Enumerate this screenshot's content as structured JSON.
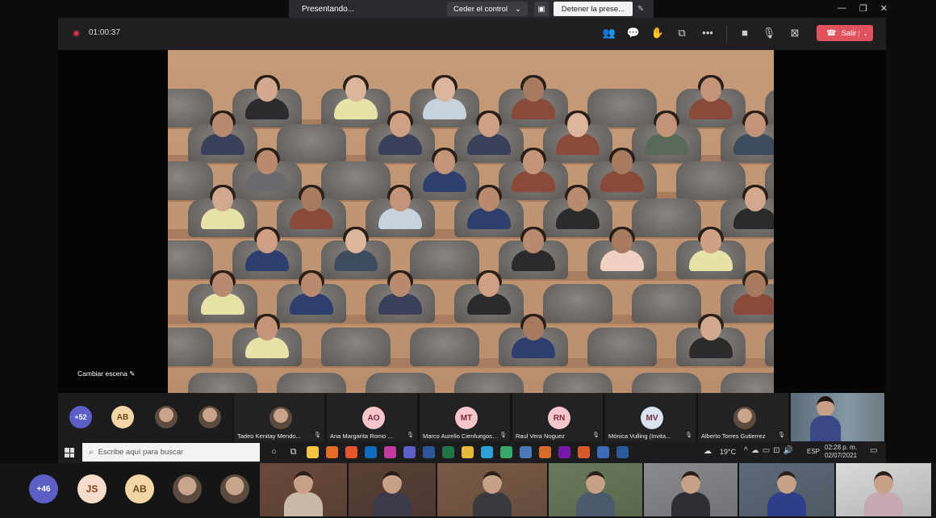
{
  "share_bar": {
    "label": "Presentando...",
    "give_control": "Ceder el control",
    "stop_presenting": "Detener la prese..."
  },
  "toolbar": {
    "timer": "01:00:37",
    "leave_label": "Salir"
  },
  "stage": {
    "change_scene": "Cambiar escena"
  },
  "strip": {
    "overflow_count": "+52",
    "avatars": [
      {
        "initials": "AB",
        "color": "#f3d6a6"
      }
    ],
    "tiles": [
      {
        "name": "Tadeo Kenitay Mendo...",
        "initials": "",
        "photo": true
      },
      {
        "name": "Ana Margarita Romo ...",
        "initials": "AO",
        "color": "#f6c6cc"
      },
      {
        "name": "Marco Aurelio Cienfuegos ...",
        "initials": "MT",
        "color": "#f6c6cc"
      },
      {
        "name": "Raul Vera Noguez",
        "initials": "RN",
        "color": "#f6c6cc"
      },
      {
        "name": "Mónica Vulling (Invita...",
        "initials": "MV",
        "color": "#d9e3ef"
      },
      {
        "name": "Alberto Torres Gutierrez",
        "initials": "",
        "photo": true
      }
    ]
  },
  "taskbar": {
    "search_placeholder": "Escribe aquí para buscar",
    "temperature": "19°C",
    "language": "ESP",
    "time": "02:28 p. m.",
    "date": "02/07/2021"
  },
  "bottom": {
    "overflow_count": "+46",
    "avatars": [
      {
        "initials": "JS",
        "color": "#f7dccc"
      },
      {
        "initials": "AB",
        "color": "#f3d6a6"
      }
    ]
  }
}
